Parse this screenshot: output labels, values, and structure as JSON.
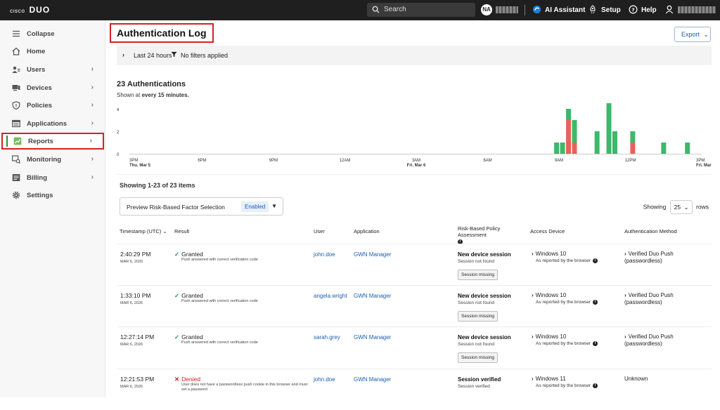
{
  "topbar": {
    "brand_small": "CISCO",
    "brand": "DUO",
    "search_placeholder": "Search",
    "avatar_initials": "NA",
    "ai_assistant": "AI Assistant",
    "setup": "Setup",
    "help": "Help"
  },
  "sidebar": {
    "items": [
      {
        "label": "Collapse",
        "icon": "menu-icon",
        "chevron": false
      },
      {
        "label": "Home",
        "icon": "home-icon",
        "chevron": false
      },
      {
        "label": "Users",
        "icon": "users-icon",
        "chevron": true
      },
      {
        "label": "Devices",
        "icon": "devices-icon",
        "chevron": true
      },
      {
        "label": "Policies",
        "icon": "shield-icon",
        "chevron": true
      },
      {
        "label": "Applications",
        "icon": "applications-icon",
        "chevron": true
      },
      {
        "label": "Reports",
        "icon": "reports-icon",
        "chevron": true,
        "active": true
      },
      {
        "label": "Monitoring",
        "icon": "monitoring-icon",
        "chevron": true
      },
      {
        "label": "Billing",
        "icon": "billing-icon",
        "chevron": true
      },
      {
        "label": "Settings",
        "icon": "gear-icon",
        "chevron": false
      }
    ]
  },
  "main": {
    "title": "Authentication Log",
    "export_label": "Export",
    "filter": {
      "range": "Last 24 hours",
      "filters": "No filters applied"
    },
    "auth_count": "23 Authentications",
    "shown_at_prefix": "Shown at",
    "shown_at_value": "every 15 minutes.",
    "showing_text": "Showing 1-23 of 23 items",
    "preview_label": "Preview Risk-Based Factor Selection",
    "preview_badge": "Enabled",
    "rows_label_pre": "Showing",
    "rows_value": "25",
    "rows_label_post": "rows",
    "columns": {
      "timestamp": "Timestamp (UTC)",
      "result": "Result",
      "user": "User",
      "application": "Application",
      "risk": "Risk-Based Policy Assessment",
      "device": "Access Device",
      "method": "Authentication Method"
    }
  },
  "table_rows": [
    {
      "time": "2:40:29 PM",
      "date": "MAR 6, 2026",
      "result": "Granted",
      "status": "granted",
      "result_desc": "Push answered with correct verification code",
      "user": "john.doe",
      "app": "GWN Manager",
      "risk_title": "New device session",
      "risk_sub": "Session not found",
      "risk_button": "Session missing",
      "device": "Windows 10",
      "device_sub": "As reported by the browser",
      "method": "Verified Duo Push (passwordless)"
    },
    {
      "time": "1:33:10 PM",
      "date": "MAR 6, 2026",
      "result": "Granted",
      "status": "granted",
      "result_desc": "Push answered with correct verification code",
      "user": "angela.wright",
      "app": "GWN Manager",
      "risk_title": "New device session",
      "risk_sub": "Session not found",
      "risk_button": "Session missing",
      "device": "Windows 10",
      "device_sub": "As reported by the browser",
      "method": "Verified Duo Push (passwordless)"
    },
    {
      "time": "12:27:14 PM",
      "date": "MAR 6, 2026",
      "result": "Granted",
      "status": "granted",
      "result_desc": "Push answered with correct verification code",
      "user": "sarah.grey",
      "app": "GWN Manager",
      "risk_title": "New device session",
      "risk_sub": "Session not found",
      "risk_button": "Session missing",
      "device": "Windows 10",
      "device_sub": "As reported by the browser",
      "method": "Verified Duo Push (passwordless)"
    },
    {
      "time": "12:21:53 PM",
      "date": "MAR 6, 2026",
      "result": "Denied",
      "status": "denied",
      "result_desc": "User does not have a passwordless push cookie in this browser and must set a password",
      "user": "john.doe",
      "app": "GWN Manager",
      "risk_title": "Session verified",
      "risk_sub": "Session verified",
      "risk_button": "",
      "device": "Windows 11",
      "device_sub": "As reported by the browser",
      "method": "Unknown"
    }
  ],
  "chart_data": {
    "type": "bar",
    "stacked": true,
    "y_ticks": [
      "4",
      "2",
      "0"
    ],
    "ylim": [
      0,
      4
    ],
    "x_ticks": [
      {
        "label": "3PM",
        "sub": "Thu. Mar 5"
      },
      {
        "label": "6PM",
        "sub": ""
      },
      {
        "label": "9PM",
        "sub": ""
      },
      {
        "label": "12AM",
        "sub": ""
      },
      {
        "label": "3AM",
        "sub": "Fri. Mar 6"
      },
      {
        "label": "6AM",
        "sub": ""
      },
      {
        "label": "9AM",
        "sub": ""
      },
      {
        "label": "12PM",
        "sub": ""
      },
      {
        "label": "3PM",
        "sub": "Fri. Mar 6"
      }
    ],
    "x_hours": [
      0,
      3,
      6,
      9,
      12,
      15,
      18,
      21,
      24
    ],
    "colors": {
      "granted": "#3cb96b",
      "denied": "#e8625a"
    },
    "bars": [
      {
        "hour": 17.9,
        "granted": 1,
        "denied": 0
      },
      {
        "hour": 18.15,
        "granted": 1,
        "denied": 0
      },
      {
        "hour": 18.4,
        "granted": 1,
        "denied": 3
      },
      {
        "hour": 18.65,
        "granted": 2,
        "denied": 1
      },
      {
        "hour": 19.6,
        "granted": 2,
        "denied": 0
      },
      {
        "hour": 20.1,
        "granted": 5,
        "denied": 0
      },
      {
        "hour": 20.35,
        "granted": 2,
        "denied": 0
      },
      {
        "hour": 21.1,
        "granted": 1,
        "denied": 1
      },
      {
        "hour": 22.4,
        "granted": 1,
        "denied": 0
      },
      {
        "hour": 23.4,
        "granted": 1,
        "denied": 0
      }
    ]
  }
}
